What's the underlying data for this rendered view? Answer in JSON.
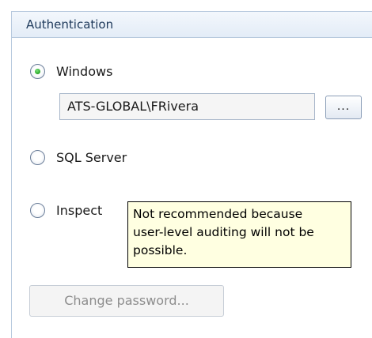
{
  "panel": {
    "title": "Authentication"
  },
  "auth_options": {
    "windows_label": "Windows",
    "windows_selected": true,
    "sql_server_label": "SQL Server",
    "sql_server_selected": false,
    "inspect_label": "Inspect",
    "inspect_selected": false
  },
  "windows_user": {
    "value": "ATS-GLOBAL\\FRivera",
    "browse_label": "..."
  },
  "tooltip": {
    "line1": "Not recommended because",
    "line2": "user-level auditing will not be",
    "line3": "possible."
  },
  "change_password": {
    "label": "Change password...",
    "enabled": false
  }
}
